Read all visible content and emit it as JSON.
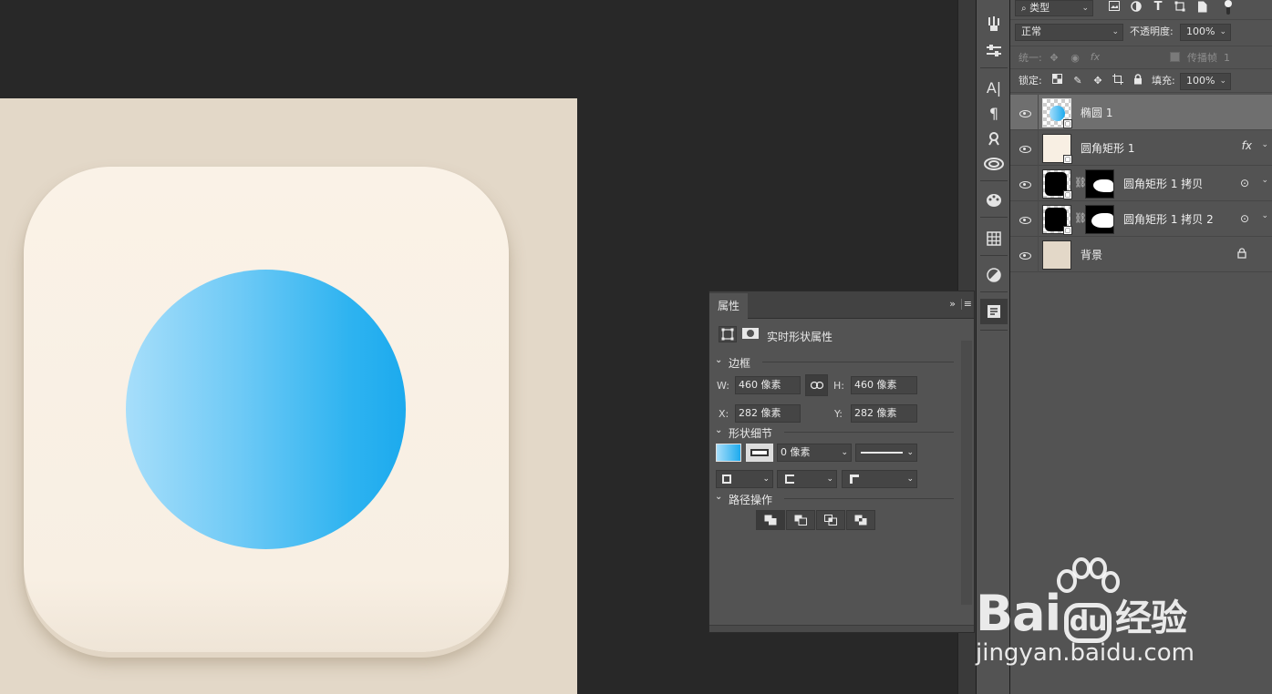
{
  "layers_panel": {
    "filter_kind": "类型",
    "blend_mode": "正常",
    "opacity_label": "不透明度:",
    "opacity_value": "100%",
    "unify_label": "统一:",
    "propagate_label": "传播帧",
    "propagate_value": "1",
    "lock_label": "锁定:",
    "fill_label": "填充:",
    "fill_value": "100%",
    "layers": [
      {
        "name": "椭圆 1",
        "selected": true,
        "fx": false
      },
      {
        "name": "圆角矩形 1",
        "selected": false,
        "fx": true,
        "fx_label": "fx"
      },
      {
        "name": "圆角矩形 1 拷贝",
        "selected": false,
        "fx": false
      },
      {
        "name": "圆角矩形 1 拷贝 2",
        "selected": false,
        "fx": false
      },
      {
        "name": "背景",
        "selected": false,
        "locked": true
      }
    ]
  },
  "properties_panel": {
    "tab_label": "属性",
    "header": "实时形状属性",
    "section_bounds": "边框",
    "w_label": "W:",
    "w_value": "460 像素",
    "h_label": "H:",
    "h_value": "460 像素",
    "x_label": "X:",
    "x_value": "282 像素",
    "y_label": "Y:",
    "y_value": "282 像素",
    "section_shape": "形状细节",
    "stroke_width": "0 像素",
    "section_path": "路径操作"
  },
  "canvas": {
    "background_color": "#e3d8c8",
    "icon_color": "#f9f0e5",
    "circle_gradient": [
      "#a7defa",
      "#1caaee"
    ]
  },
  "watermark": {
    "logo_text": "Bai",
    "logo_suffix": "经验",
    "url": "jingyan.baidu.com"
  }
}
